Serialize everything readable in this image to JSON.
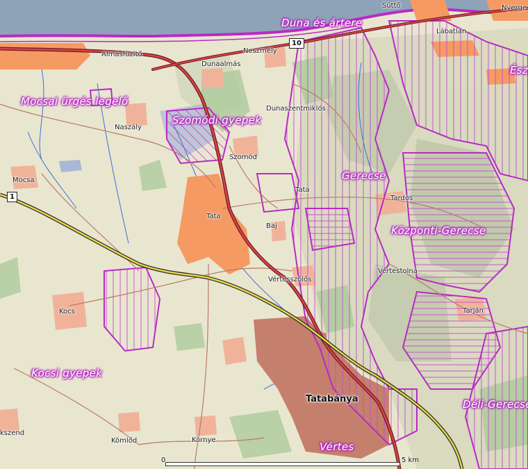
{
  "map": {
    "colors": {
      "background": "#e9e6cf",
      "water": "#8fa3b8",
      "urban": "#f59a62",
      "urban_dense": "#c4806c",
      "protected_area": "#b72bc4",
      "motorway": "#e6d84a",
      "main_road": "#b5373a",
      "forest": "#9fbf8f"
    },
    "area_labels": [
      {
        "id": "duna",
        "text": "Duna és ártere"
      },
      {
        "id": "mocsai",
        "text": "Mocsai ürgés legelő"
      },
      {
        "id": "szomodi",
        "text": "Szomódi gyepek"
      },
      {
        "id": "gerecse",
        "text": "Gerecse"
      },
      {
        "id": "kozponti",
        "text": "Központi-Gerecse"
      },
      {
        "id": "kocsi",
        "text": "Kocsi gyepek"
      },
      {
        "id": "deli",
        "text": "Déli-Gerecse"
      },
      {
        "id": "vertes",
        "text": "Vértes"
      },
      {
        "id": "esz",
        "text": "Ész"
      }
    ],
    "places": [
      {
        "id": "sutto",
        "text": "Süttő"
      },
      {
        "id": "nyergesujfalu",
        "text": "Nyerge"
      },
      {
        "id": "labatlan",
        "text": "Lábatlan"
      },
      {
        "id": "almasfuzito",
        "text": "Almásfüzitő"
      },
      {
        "id": "neszmely",
        "text": "Neszmély"
      },
      {
        "id": "dunaalmas",
        "text": "Dunaalmás"
      },
      {
        "id": "dunaszentmiklos",
        "text": "Dunaszentmiklós"
      },
      {
        "id": "naszaly",
        "text": "Naszály"
      },
      {
        "id": "szomod",
        "text": "Szomód"
      },
      {
        "id": "mocsa",
        "text": "Mocsa"
      },
      {
        "id": "tata_village",
        "text": "Tata"
      },
      {
        "id": "tardos",
        "text": "Tardos"
      },
      {
        "id": "tata",
        "text": "Tata"
      },
      {
        "id": "baj",
        "text": "Baj"
      },
      {
        "id": "vertestolna",
        "text": "Vértestolna"
      },
      {
        "id": "vertesszolos",
        "text": "Vértesszőlős"
      },
      {
        "id": "tarjan",
        "text": "Tarján"
      },
      {
        "id": "kocs",
        "text": "Kocs"
      },
      {
        "id": "tatabanya",
        "text": "Tatabánya"
      },
      {
        "id": "kemlod",
        "text": "Kömlőd"
      },
      {
        "id": "kornye",
        "text": "Környe"
      },
      {
        "id": "kszend",
        "text": "kszend"
      }
    ],
    "road_shields": [
      {
        "id": "r10",
        "text": "10"
      },
      {
        "id": "r1",
        "text": "1"
      }
    ],
    "scale": {
      "start": "0",
      "end": "5 km"
    }
  }
}
